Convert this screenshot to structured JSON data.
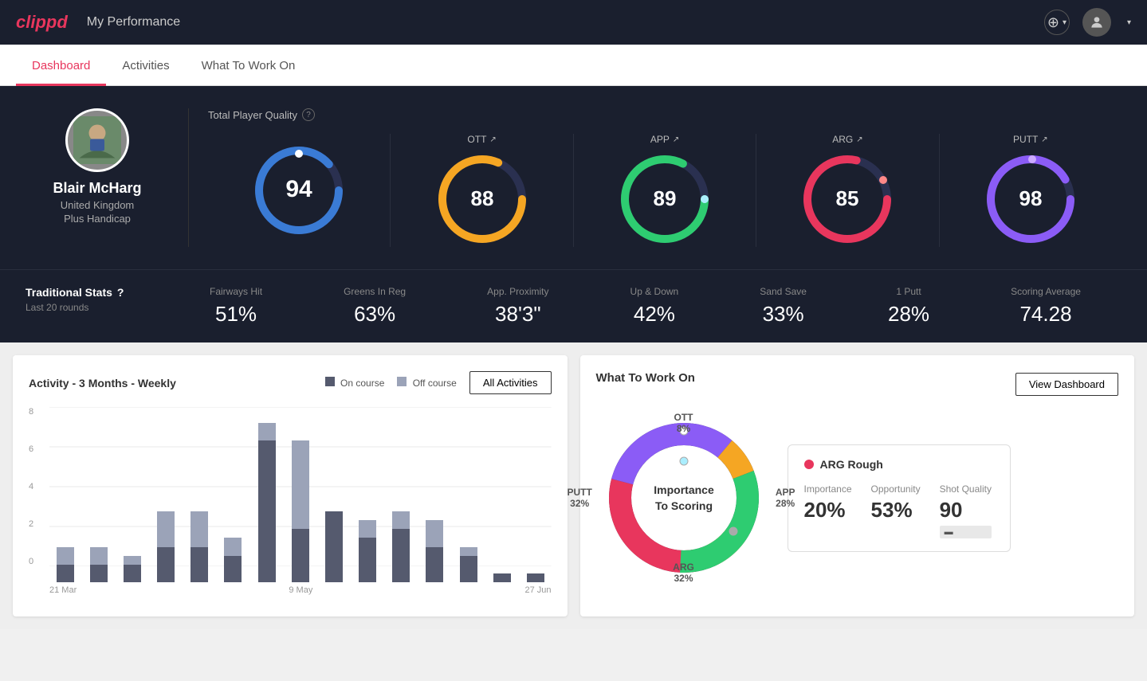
{
  "app": {
    "logo": "clippd",
    "header_title": "My Performance"
  },
  "nav": {
    "tabs": [
      {
        "label": "Dashboard",
        "active": true
      },
      {
        "label": "Activities",
        "active": false
      },
      {
        "label": "What To Work On",
        "active": false
      }
    ]
  },
  "player": {
    "name": "Blair McHarg",
    "country": "United Kingdom",
    "handicap": "Plus Handicap"
  },
  "quality": {
    "label": "Total Player Quality",
    "main": {
      "value": "94",
      "color": "#3a7bd5"
    },
    "metrics": [
      {
        "label": "OTT",
        "value": "88",
        "color": "#f5a623"
      },
      {
        "label": "APP",
        "value": "89",
        "color": "#2ecc71"
      },
      {
        "label": "ARG",
        "value": "85",
        "color": "#e8365d"
      },
      {
        "label": "PUTT",
        "value": "98",
        "color": "#8b5cf6"
      }
    ]
  },
  "traditional_stats": {
    "title": "Traditional Stats",
    "subtitle": "Last 20 rounds",
    "stats": [
      {
        "label": "Fairways Hit",
        "value": "51%"
      },
      {
        "label": "Greens In Reg",
        "value": "63%"
      },
      {
        "label": "App. Proximity",
        "value": "38'3\""
      },
      {
        "label": "Up & Down",
        "value": "42%"
      },
      {
        "label": "Sand Save",
        "value": "33%"
      },
      {
        "label": "1 Putt",
        "value": "28%"
      },
      {
        "label": "Scoring Average",
        "value": "74.28"
      }
    ]
  },
  "activity_chart": {
    "title": "Activity - 3 Months - Weekly",
    "legend": [
      {
        "label": "On course",
        "color": "#555a6e"
      },
      {
        "label": "Off course",
        "color": "#9ba3b8"
      }
    ],
    "all_activities_btn": "All Activities",
    "y_labels": [
      "8",
      "6",
      "4",
      "2",
      "0"
    ],
    "x_labels": [
      "21 Mar",
      "9 May",
      "27 Jun"
    ],
    "bars": [
      {
        "on": 1,
        "off": 1
      },
      {
        "on": 1,
        "off": 1
      },
      {
        "on": 1,
        "off": 0.5
      },
      {
        "on": 2,
        "off": 2
      },
      {
        "on": 2,
        "off": 2
      },
      {
        "on": 1.5,
        "off": 1
      },
      {
        "on": 8,
        "off": 1
      },
      {
        "on": 3,
        "off": 5
      },
      {
        "on": 4,
        "off": 0
      },
      {
        "on": 2.5,
        "off": 1
      },
      {
        "on": 3,
        "off": 1
      },
      {
        "on": 2,
        "off": 1.5
      },
      {
        "on": 1.5,
        "off": 0.5
      },
      {
        "on": 0.5,
        "off": 0
      },
      {
        "on": 0.5,
        "off": 0
      }
    ]
  },
  "what_to_work_on": {
    "title": "What To Work On",
    "view_dashboard_btn": "View Dashboard",
    "donut_center_line1": "Importance",
    "donut_center_line2": "To Scoring",
    "segments": [
      {
        "label": "OTT",
        "value": "8%",
        "color": "#f5a623"
      },
      {
        "label": "APP",
        "value": "28%",
        "color": "#2ecc71"
      },
      {
        "label": "ARG",
        "value": "32%",
        "color": "#e8365d"
      },
      {
        "label": "PUTT",
        "value": "32%",
        "color": "#8b5cf6"
      }
    ],
    "info_card": {
      "title": "ARG Rough",
      "dot_color": "#e8365d",
      "metrics": [
        {
          "label": "Importance",
          "value": "20%"
        },
        {
          "label": "Opportunity",
          "value": "53%"
        },
        {
          "label": "Shot Quality",
          "value": "90",
          "badge": true
        }
      ]
    }
  }
}
